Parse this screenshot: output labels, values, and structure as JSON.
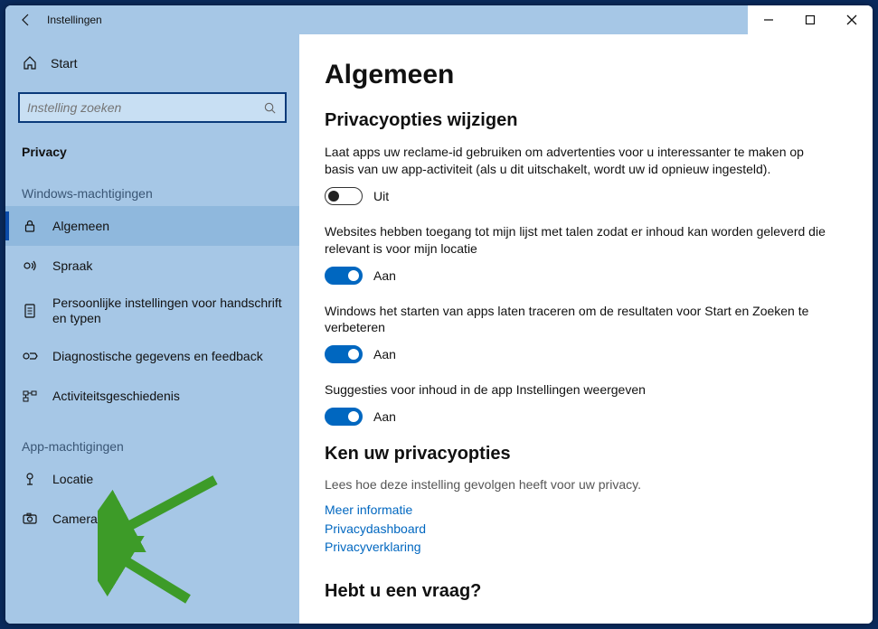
{
  "window": {
    "title": "Instellingen"
  },
  "sidebar": {
    "home": "Start",
    "search_placeholder": "Instelling zoeken",
    "category": "Privacy",
    "group_windows": "Windows-machtigingen",
    "group_app": "App-machtigingen",
    "items_windows": [
      {
        "label": "Algemeen"
      },
      {
        "label": "Spraak"
      },
      {
        "label": "Persoonlijke instellingen voor handschrift en typen"
      },
      {
        "label": "Diagnostische gegevens en feedback"
      },
      {
        "label": "Activiteitsgeschiedenis"
      }
    ],
    "items_app": [
      {
        "label": "Locatie"
      },
      {
        "label": "Camera"
      }
    ]
  },
  "main": {
    "title": "Algemeen",
    "section1_title": "Privacyopties wijzigen",
    "options": [
      {
        "text": "Laat apps uw reclame-id gebruiken om advertenties voor u interessanter te maken op basis van uw app-activiteit (als u dit uitschakelt, wordt uw id opnieuw ingesteld).",
        "state_label": "Uit",
        "on": false
      },
      {
        "text": "Websites hebben toegang tot mijn lijst met talen zodat er inhoud kan worden geleverd die relevant is voor mijn locatie",
        "state_label": "Aan",
        "on": true
      },
      {
        "text": "Windows het starten van apps laten traceren om de resultaten voor Start en Zoeken te verbeteren",
        "state_label": "Aan",
        "on": true
      },
      {
        "text": "Suggesties voor inhoud in de app Instellingen weergeven",
        "state_label": "Aan",
        "on": true
      }
    ],
    "know_title": "Ken uw privacyopties",
    "know_desc": "Lees hoe deze instelling gevolgen heeft voor uw privacy.",
    "links": [
      "Meer informatie",
      "Privacydashboard",
      "Privacyverklaring"
    ],
    "bottom_question": "Hebt u een vraag?"
  }
}
